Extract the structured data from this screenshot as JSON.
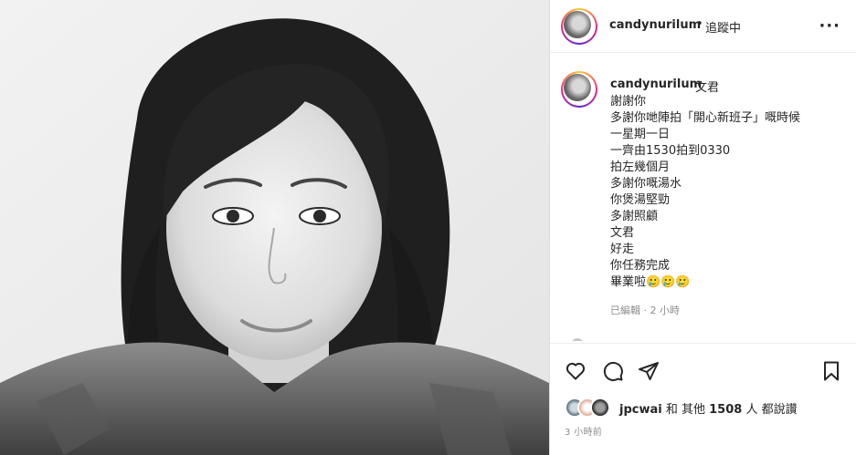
{
  "post_header": {
    "username": "candynurilum",
    "separator": "•",
    "follow_status": "追蹤中",
    "more_label": "···"
  },
  "caption": {
    "username": "candynurilum",
    "alias": "文君",
    "lines": [
      "謝謝你",
      "多謝你哋陣拍「開心新班子」嘅時候",
      "一星期一日",
      "一齊由1530拍到0330",
      "拍左幾個月",
      "多謝你嘅湯水",
      "你煲湯堅勁",
      "多謝照顧",
      "文君",
      "好走",
      "你任務完成",
      "畢業啦🥲🥲🥲"
    ],
    "meta": "已編輯 · 2 小時"
  },
  "actions": {
    "like_icon": "heart-icon",
    "comment_icon": "comment-icon",
    "share_icon": "paper-plane-icon",
    "save_icon": "bookmark-icon"
  },
  "likes": {
    "user": "jpcwai",
    "middle": " 和 其他 ",
    "count": "1508",
    "suffix": " 人 都說讚"
  },
  "timestamp": "3 小時前",
  "colors": {
    "text": "#262626",
    "muted": "#8e8e8e",
    "border": "#dbdbdb"
  }
}
